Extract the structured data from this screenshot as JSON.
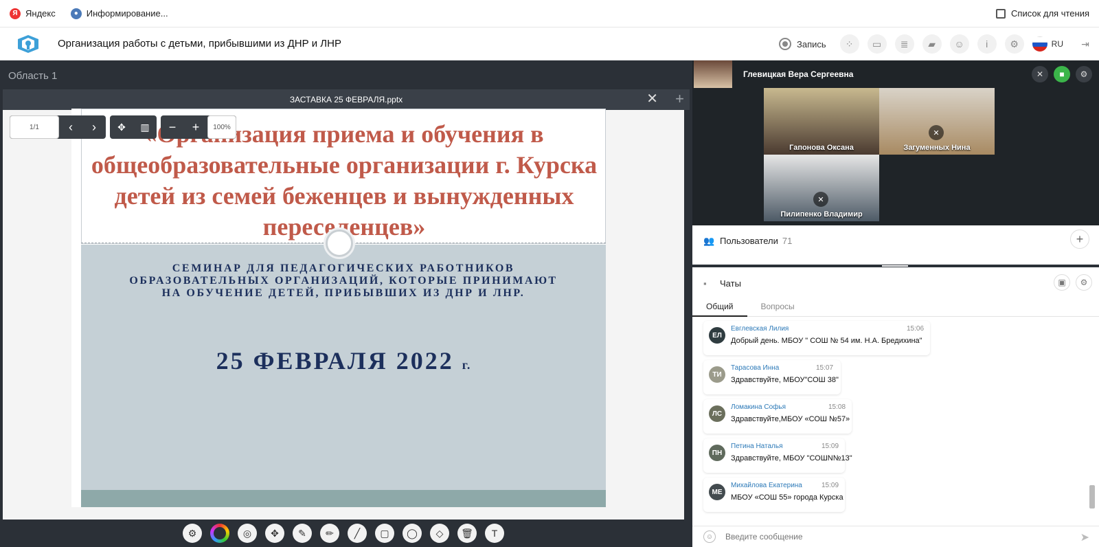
{
  "bookmarks": {
    "items": [
      {
        "label": "Яндекс",
        "icon": "yandex-icon"
      },
      {
        "label": "Информирование...",
        "icon": "emblem-icon"
      }
    ],
    "reading_list": "Список для чтения"
  },
  "header": {
    "title": "Организация работы с детьми, прибывшими из ДНР и ЛНР",
    "record_label": "Запись",
    "lang": "RU"
  },
  "area": {
    "label": "Область 1",
    "doc_title": "ЗАСТАВКА 25 ФЕВРАЛЯ.pptx",
    "page_indicator": "1/1",
    "zoom": "100%"
  },
  "slide": {
    "title": "«Организация приема и обучения в общеобразовательные организации г. Курска детей из семей беженцев и вынужденных переселенцев»",
    "subtitle": "СЕМИНАР ДЛЯ ПЕДАГОГИЧЕСКИХ РАБОТНИКОВ ОБРАЗОВАТЕЛЬНЫХ ОРГАНИЗАЦИЙ, КОТОРЫЕ ПРИНИМАЮТ НА ОБУЧЕНИЕ ДЕТЕЙ, ПРИБЫВШИХ ИЗ ДНР И ЛНР.",
    "date": "25 ФЕВРАЛЯ 2022",
    "date_suffix": "г."
  },
  "video": {
    "presenter": "Глевицкая Вера Сергеевна",
    "tiles": [
      {
        "name": "Гапонова Оксана"
      },
      {
        "name": "Загуменных Нина"
      },
      {
        "name": "Пилипенко Владимир"
      }
    ]
  },
  "users": {
    "label": "Пользователи",
    "count": "71"
  },
  "chat": {
    "title": "Чаты",
    "tabs": [
      "Общий",
      "Вопросы"
    ],
    "messages": [
      {
        "initials": "ЕЛ",
        "author": "Евглевская Лилия",
        "time": "15:06",
        "text": "Добрый день. МБОУ \" СОШ № 54 им. Н.А. Бредихина\"",
        "color": "#2f3c40"
      },
      {
        "initials": "ТИ",
        "author": "Тарасова Инна",
        "time": "15:07",
        "text": "Здравствуйте, МБОУ\"СОШ 38\"",
        "color": "#9b9b8b"
      },
      {
        "initials": "ЛС",
        "author": "Ломакина Софья",
        "time": "15:08",
        "text": "Здравствуйте,МБОУ «СОШ №57»",
        "color": "#6b6f5c"
      },
      {
        "initials": "ПН",
        "author": "Петина Наталья",
        "time": "15:09",
        "text": "Здравствуйте, МБОУ \"СОШN№13\"",
        "color": "#5f6a5c"
      },
      {
        "initials": "МЕ",
        "author": "Михайлова Екатерина",
        "time": "15:09",
        "text": "МБОУ «СОШ 55» города Курска",
        "color": "#434b4f"
      }
    ],
    "input_placeholder": "Введите сообщение"
  }
}
